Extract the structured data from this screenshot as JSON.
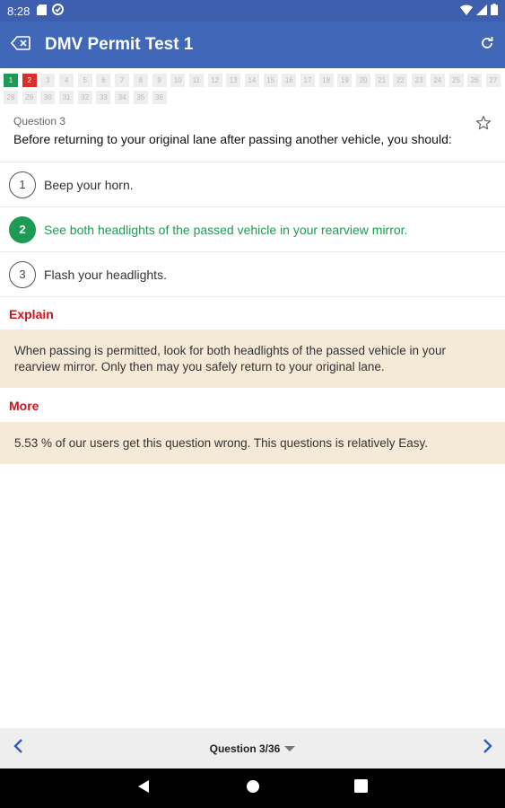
{
  "status_bar": {
    "time": "8:28"
  },
  "app_bar": {
    "title": "DMV Permit Test 1"
  },
  "question_grid": {
    "items": [
      {
        "n": "1",
        "state": "correct"
      },
      {
        "n": "2",
        "state": "wrong"
      },
      {
        "n": "3",
        "state": "none"
      },
      {
        "n": "4",
        "state": "none"
      },
      {
        "n": "5",
        "state": "none"
      },
      {
        "n": "6",
        "state": "none"
      },
      {
        "n": "7",
        "state": "none"
      },
      {
        "n": "8",
        "state": "none"
      },
      {
        "n": "9",
        "state": "none"
      },
      {
        "n": "10",
        "state": "none"
      },
      {
        "n": "11",
        "state": "none"
      },
      {
        "n": "12",
        "state": "none"
      },
      {
        "n": "13",
        "state": "none"
      },
      {
        "n": "14",
        "state": "none"
      },
      {
        "n": "15",
        "state": "none"
      },
      {
        "n": "16",
        "state": "none"
      },
      {
        "n": "17",
        "state": "none"
      },
      {
        "n": "18",
        "state": "none"
      },
      {
        "n": "19",
        "state": "none"
      },
      {
        "n": "20",
        "state": "none"
      },
      {
        "n": "21",
        "state": "none"
      },
      {
        "n": "22",
        "state": "none"
      },
      {
        "n": "23",
        "state": "none"
      },
      {
        "n": "24",
        "state": "none"
      },
      {
        "n": "25",
        "state": "none"
      },
      {
        "n": "26",
        "state": "none"
      },
      {
        "n": "27",
        "state": "none"
      },
      {
        "n": "28",
        "state": "none"
      },
      {
        "n": "29",
        "state": "none"
      },
      {
        "n": "30",
        "state": "none"
      },
      {
        "n": "31",
        "state": "none"
      },
      {
        "n": "32",
        "state": "none"
      },
      {
        "n": "33",
        "state": "none"
      },
      {
        "n": "34",
        "state": "none"
      },
      {
        "n": "35",
        "state": "none"
      },
      {
        "n": "36",
        "state": "none"
      }
    ]
  },
  "question": {
    "label": "Question 3",
    "text": "Before returning to your original lane after passing another vehicle, you should:"
  },
  "answers": [
    {
      "num": "1",
      "text": "Beep your horn.",
      "selected": false
    },
    {
      "num": "2",
      "text": "See both headlights of the passed vehicle in your rearview mirror.",
      "selected": true
    },
    {
      "num": "3",
      "text": "Flash your headlights.",
      "selected": false
    }
  ],
  "explain": {
    "title": "Explain",
    "text": "When passing is permitted, look for both headlights of the passed vehicle in your rearview mirror. Only then may you safely return to your original lane."
  },
  "more": {
    "title": "More",
    "text": "5.53 % of our users get this question wrong. This questions is relatively Easy."
  },
  "bottom_bar": {
    "selector_label": "Question 3/36"
  },
  "colors": {
    "app_bar": "#4167b8",
    "correct": "#1e9a55",
    "wrong": "#d6302c",
    "section_title": "#c8161d",
    "panel": "#f4ead7"
  }
}
